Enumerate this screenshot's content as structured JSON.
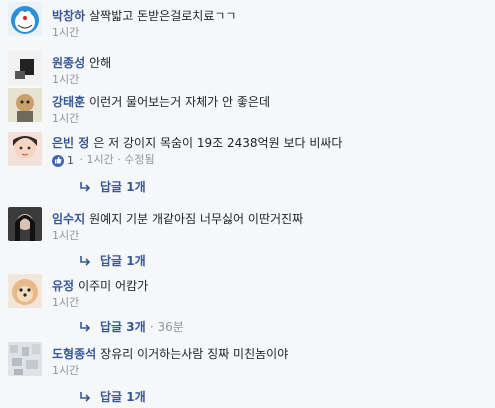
{
  "comments": [
    {
      "name": "박창하",
      "text": "살짝밟고 돈받은걸로치료ㄱㄱ",
      "time": "1시간"
    },
    {
      "name": "원종성",
      "text": "안해",
      "time": "1시간"
    },
    {
      "name": "강태훈",
      "text": "이런거 물어보는거 자체가 안 좋은데",
      "time": "1시간"
    },
    {
      "name": "은빈 정",
      "text": "은 저 강이지 목숨이 19조 2438억원 보다 비싸다",
      "likes": "1",
      "dot": "·",
      "time": "1시간",
      "edited": "· 수정됨",
      "reply_label": "답글 1개"
    },
    {
      "name": "임수지",
      "text": "원예지 기분 개같아짐 너무싫어 이딴거진짜",
      "time": "1시간",
      "reply_label": "답글 1개"
    },
    {
      "name": "유정",
      "text": "이주미 어캄가",
      "time": "1시간",
      "reply_label": "답글 3개",
      "reply_extra": "· 36분"
    },
    {
      "name": "도형종석",
      "text": "장유리 이거하는사람 징짜 미친놈이야",
      "time": "1시간",
      "reply_label": "답글 1개"
    }
  ],
  "icons": {
    "like": "thumbs-up-icon",
    "reply": "reply-arrow-icon"
  },
  "colors": {
    "name": "#365899",
    "meta": "#90949c",
    "like_badge": "#4267b2",
    "background": "#f6f7f9"
  }
}
